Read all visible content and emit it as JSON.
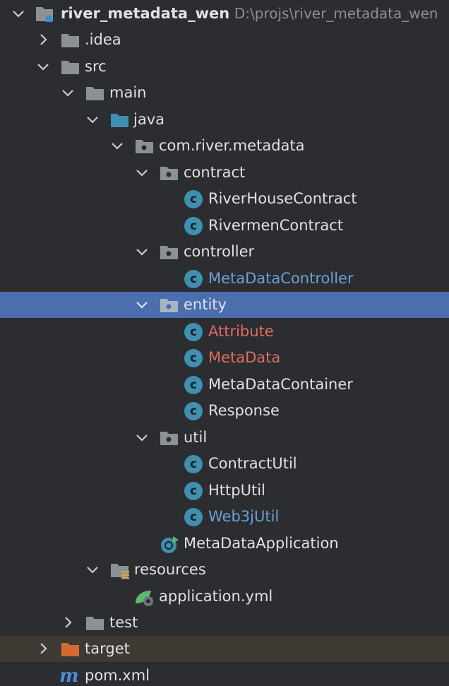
{
  "project": {
    "name": "river_metadata_wen",
    "path": "D:\\projs\\river_metadata_wen"
  },
  "nodes": [
    {
      "id": "idea",
      "label": ".idea",
      "color": "#dfe1e5"
    },
    {
      "id": "src",
      "label": "src",
      "color": "#dfe1e5"
    },
    {
      "id": "main",
      "label": "main",
      "color": "#dfe1e5"
    },
    {
      "id": "java",
      "label": "java",
      "color": "#dfe1e5"
    },
    {
      "id": "pkg",
      "label": "com.river.metadata",
      "color": "#dfe1e5"
    },
    {
      "id": "contract",
      "label": "contract",
      "color": "#dfe1e5"
    },
    {
      "id": "RiverHouseContract",
      "label": "RiverHouseContract",
      "color": "#dfe1e5"
    },
    {
      "id": "RivermenContract",
      "label": "RivermenContract",
      "color": "#dfe1e5"
    },
    {
      "id": "controller",
      "label": "controller",
      "color": "#dfe1e5"
    },
    {
      "id": "MetaDataController",
      "label": "MetaDataController",
      "color": "#6e9fd6"
    },
    {
      "id": "entity",
      "label": "entity",
      "color": "#dfe1e5"
    },
    {
      "id": "Attribute",
      "label": "Attribute",
      "color": "#e06c61"
    },
    {
      "id": "MetaData",
      "label": "MetaData",
      "color": "#e06c61"
    },
    {
      "id": "MetaDataContainer",
      "label": "MetaDataContainer",
      "color": "#dfe1e5"
    },
    {
      "id": "Response",
      "label": "Response",
      "color": "#dfe1e5"
    },
    {
      "id": "util",
      "label": "util",
      "color": "#dfe1e5"
    },
    {
      "id": "ContractUtil",
      "label": "ContractUtil",
      "color": "#dfe1e5"
    },
    {
      "id": "HttpUtil",
      "label": "HttpUtil",
      "color": "#dfe1e5"
    },
    {
      "id": "Web3jUtil",
      "label": "Web3jUtil",
      "color": "#6e9fd6"
    },
    {
      "id": "MetaDataApplication",
      "label": "MetaDataApplication",
      "color": "#dfe1e5"
    },
    {
      "id": "resources",
      "label": "resources",
      "color": "#dfe1e5"
    },
    {
      "id": "application_yml",
      "label": "application.yml",
      "color": "#dfe1e5"
    },
    {
      "id": "test",
      "label": "test",
      "color": "#dfe1e5"
    },
    {
      "id": "target",
      "label": "target",
      "color": "#dfe1e5"
    },
    {
      "id": "pom_xml",
      "label": "pom.xml",
      "color": "#dfe1e5"
    }
  ],
  "icons": {
    "folder": "folder-icon",
    "source_folder": "source-folder-icon",
    "package": "package-icon",
    "class": "class-icon",
    "spring_boot_app": "spring-boot-application-icon",
    "resources_folder": "resources-folder-icon",
    "yml": "spring-yml-icon",
    "excluded_folder": "excluded-folder-icon",
    "maven": "maven-icon"
  },
  "colors": {
    "background": "#2b2d30",
    "selection": "#4b6eaf",
    "excluded_row": "#3e3a33",
    "text": "#dfe1e5",
    "modified": "#6e9fd6",
    "error": "#e06c61"
  }
}
